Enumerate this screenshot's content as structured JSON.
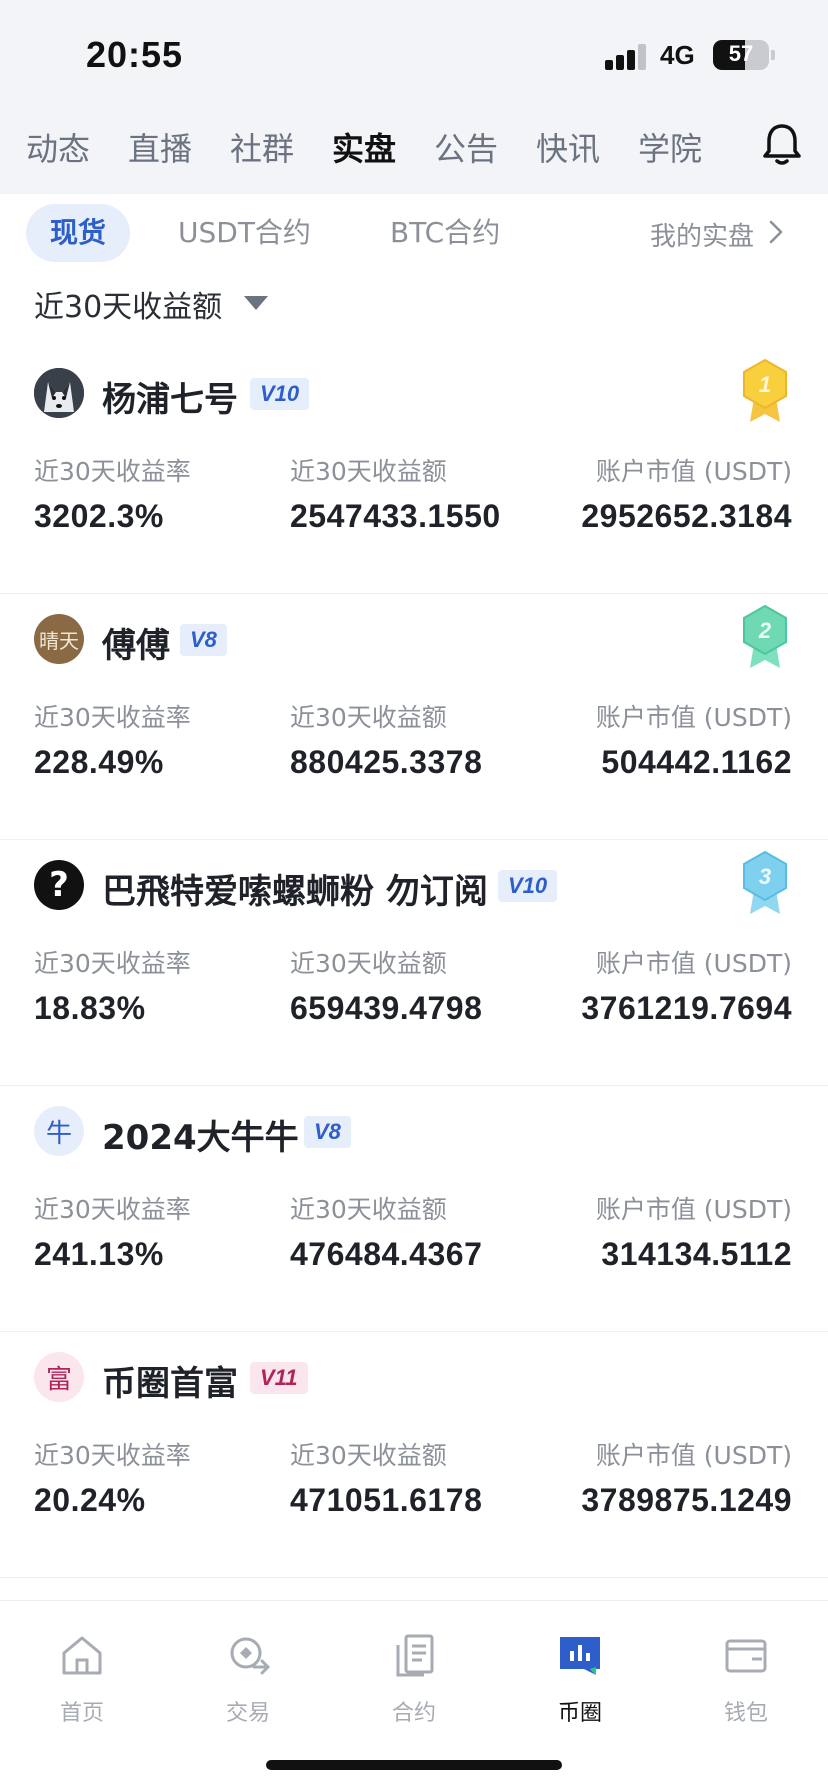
{
  "status_bar": {
    "time": "20:55",
    "network": "4G",
    "battery": "57",
    "battery_level": 0.57
  },
  "top_nav": {
    "items": [
      {
        "label": "动态",
        "active": false
      },
      {
        "label": "直播",
        "active": false
      },
      {
        "label": "社群",
        "active": false
      },
      {
        "label": "实盘",
        "active": true
      },
      {
        "label": "公告",
        "active": false
      },
      {
        "label": "快讯",
        "active": false
      },
      {
        "label": "学院",
        "active": false
      }
    ]
  },
  "sub_tabs": {
    "items": [
      {
        "label": "现货",
        "active": true
      },
      {
        "label": "USDT合约",
        "active": false
      },
      {
        "label": "BTC合约",
        "active": false
      }
    ],
    "my_real": "我的实盘"
  },
  "filter": {
    "label": "近30天收益额"
  },
  "columns": {
    "rate": "近30天收益率",
    "profit": "近30天收益额",
    "market": "账户市值 (USDT)"
  },
  "traders": [
    {
      "name": "杨浦七号",
      "level": "V10",
      "rank": "1",
      "rate": "3202.3%",
      "profit": "2547433.1550",
      "market": "2952652.3184",
      "avatar_text": "",
      "level_color": "#2d5ec9",
      "level_bg": "#e6eefc"
    },
    {
      "name": "傅傅",
      "level": "V8",
      "rank": "2",
      "rate": "228.49%",
      "profit": "880425.3378",
      "market": "504442.1162",
      "avatar_text": "晴天",
      "level_color": "#2d5ec9",
      "level_bg": "#e6eefc"
    },
    {
      "name": "巴飛特爱嗦螺蛳粉 勿订阅",
      "level": "V10",
      "rank": "3",
      "rate": "18.83%",
      "profit": "659439.4798",
      "market": "3761219.7694",
      "avatar_text": "?",
      "level_color": "#2d5ec9",
      "level_bg": "#e6eefc"
    },
    {
      "name": "2024大牛牛",
      "level": "V8",
      "rank": "",
      "rate": "241.13%",
      "profit": "476484.4367",
      "market": "314134.5112",
      "avatar_text": "牛",
      "level_color": "#2d5ec9",
      "level_bg": "#e6eefc"
    },
    {
      "name": "币圈首富",
      "level": "V11",
      "rank": "",
      "rate": "20.24%",
      "profit": "471051.6178",
      "market": "3789875.1249",
      "avatar_text": "富",
      "level_color": "#b0245a",
      "level_bg": "#fbe6ee"
    }
  ],
  "bottom_tabs": [
    {
      "label": "首页",
      "icon": "home-icon",
      "active": false
    },
    {
      "label": "交易",
      "icon": "trade-icon",
      "active": false
    },
    {
      "label": "合约",
      "icon": "contract-icon",
      "active": false
    },
    {
      "label": "币圈",
      "icon": "community-icon",
      "active": true
    },
    {
      "label": "钱包",
      "icon": "wallet-icon",
      "active": false
    }
  ],
  "colors": {
    "accent": "#2d5ec9",
    "active_tab_bg": "#e7eefb",
    "highlight": "#bff0dc"
  }
}
